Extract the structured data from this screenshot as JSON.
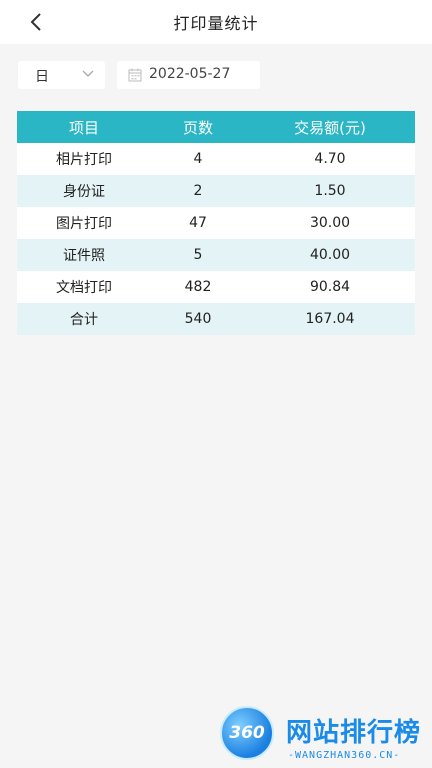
{
  "header": {
    "title": "打印量统计"
  },
  "filters": {
    "period": "日",
    "date": "2022-05-27"
  },
  "table": {
    "columns": [
      "项目",
      "页数",
      "交易额(元)"
    ],
    "rows": [
      [
        "相片打印",
        "4",
        "4.70"
      ],
      [
        "身份证",
        "2",
        "1.50"
      ],
      [
        "图片打印",
        "47",
        "30.00"
      ],
      [
        "证件照",
        "5",
        "40.00"
      ],
      [
        "文档打印",
        "482",
        "90.84"
      ],
      [
        "合计",
        "540",
        "167.04"
      ]
    ]
  },
  "watermark": {
    "logo": "360",
    "title": "网站排行榜",
    "subtitle": "-WANGZHAN360.CN-"
  },
  "colors": {
    "header_bg": "#2ab6c5",
    "row_alt": "#e4f3f6",
    "page_bg": "#f5f5f5"
  }
}
